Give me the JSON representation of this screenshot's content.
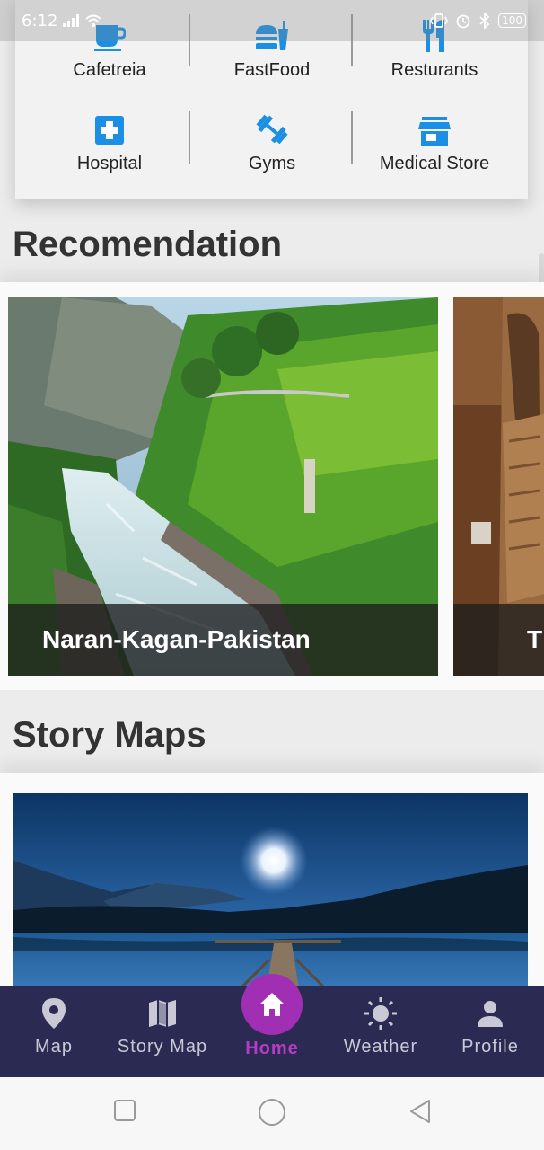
{
  "status_bar": {
    "time": "6:12",
    "battery": "100"
  },
  "categories": [
    {
      "label": "Cafetreia",
      "icon": "coffee-cup-icon"
    },
    {
      "label": "FastFood",
      "icon": "fastfood-icon"
    },
    {
      "label": "Resturants",
      "icon": "restaurant-icon"
    },
    {
      "label": "Hospital",
      "icon": "hospital-icon"
    },
    {
      "label": "Gyms",
      "icon": "dumbbell-icon"
    },
    {
      "label": "Medical Store",
      "icon": "store-icon"
    }
  ],
  "sections": {
    "recommendation_title": "Recomendation",
    "story_maps_title": "Story Maps"
  },
  "recommendations": [
    {
      "title": "Naran-Kagan-Pakistan",
      "image": "mountain-river-valley-photo"
    },
    {
      "title": "T",
      "image": "museum-statue-photo"
    }
  ],
  "story_maps": [
    {
      "image": "night-lake-pier-photo"
    }
  ],
  "bottom_nav": [
    {
      "label": "Map",
      "icon": "location-pin-icon"
    },
    {
      "label": "Story Map",
      "icon": "map-icon"
    },
    {
      "label": "Home",
      "icon": "home-icon",
      "active": true
    },
    {
      "label": "Weather",
      "icon": "sun-icon"
    },
    {
      "label": "Profile",
      "icon": "person-icon"
    }
  ],
  "colors": {
    "accent_blue": "#1a8fe3",
    "nav_background": "#2b2a52",
    "home_active": "#a12fb3"
  }
}
